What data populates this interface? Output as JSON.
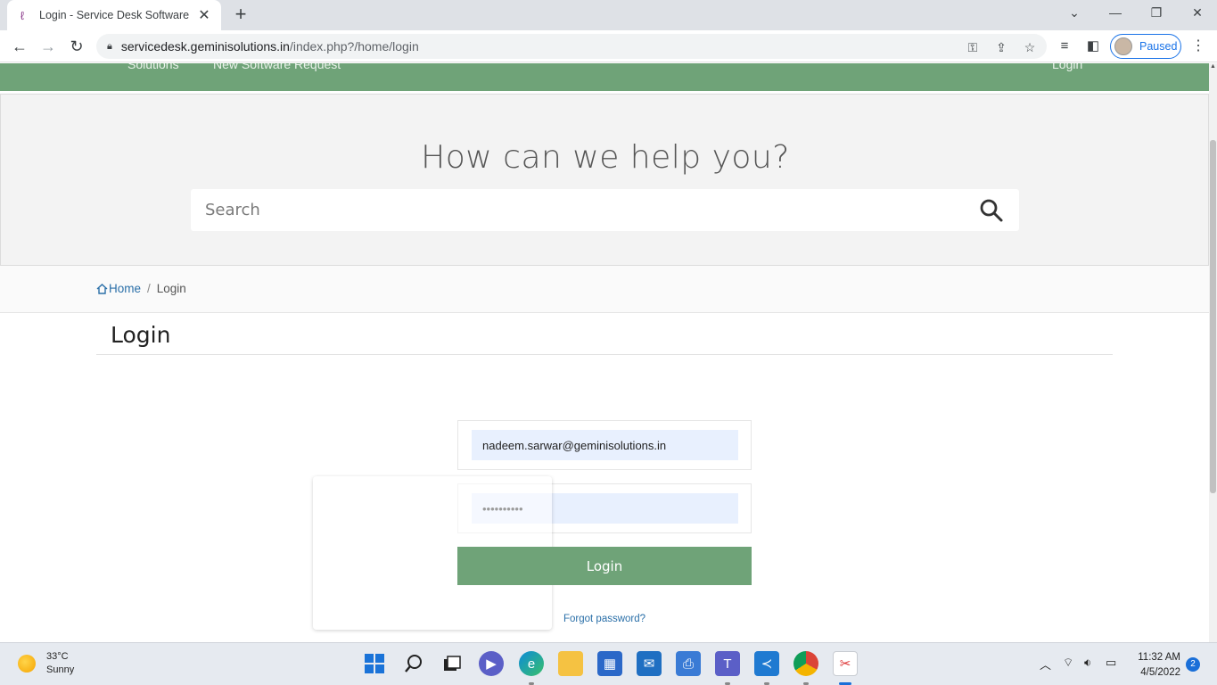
{
  "browser": {
    "tab_title": "Login - Service Desk Software by",
    "tab_close": "✕",
    "new_tab": "+",
    "url_host": "servicedesk.geminisolutions.in",
    "url_path": "/index.php?/home/login",
    "profile_status": "Paused"
  },
  "nav": {
    "items": [
      "Solutions",
      "New Software Request"
    ],
    "login_link": "Login"
  },
  "hero": {
    "heading": "How can we help you?",
    "search_placeholder": "Search"
  },
  "breadcrumb": {
    "home": "Home",
    "separator": "/",
    "current": "Login"
  },
  "page": {
    "title": "Login"
  },
  "form": {
    "email_value": "nadeem.sarwar@geminisolutions.in",
    "password_value": "••••••••••",
    "submit_label": "Login",
    "forgot_label": "Forgot password?"
  },
  "colors": {
    "brand_green": "#6fa378",
    "link_blue": "#2a6fa8",
    "autofill_bg": "#e8f0fe"
  },
  "taskbar": {
    "temperature": "33°C",
    "condition": "Sunny",
    "time": "11:32 AM",
    "date": "4/5/2022",
    "notification_count": "2"
  }
}
